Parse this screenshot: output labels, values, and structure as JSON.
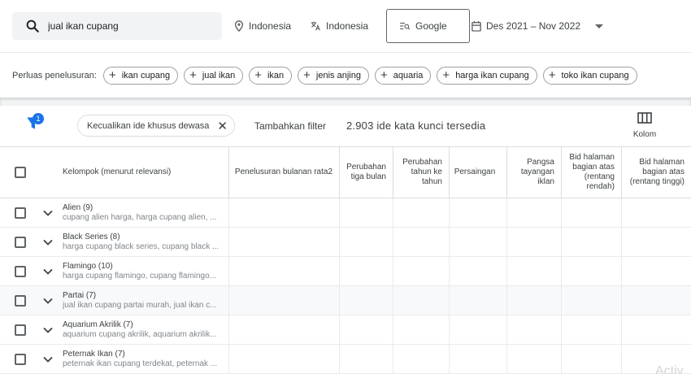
{
  "search": {
    "query": "jual ikan cupang"
  },
  "targeting": {
    "location": "Indonesia",
    "language": "Indonesia",
    "network": "Google",
    "date_range": "Des 2021 – Nov 2022"
  },
  "broaden": {
    "label": "Perluas penelusuran:",
    "chips": [
      "ikan cupang",
      "jual ikan",
      "ikan",
      "jenis anjing",
      "aquaria",
      "harga ikan cupang",
      "toko ikan cupang"
    ]
  },
  "filters": {
    "badge_count": "1",
    "exclude_chip": "Kecualikan ide khusus dewasa",
    "add_filter": "Tambahkan filter",
    "keyword_count": "2.903 ide kata kunci tersedia",
    "columns_label": "Kolom"
  },
  "table": {
    "headers": {
      "group": "Kelompok (menurut relevansi)",
      "avg_searches": "Penelusuran bulanan rata2",
      "three_month": "Perubahan tiga bulan",
      "yoy": "Perubahan tahun ke tahun",
      "competition": "Persaingan",
      "impr_share": "Pangsa tayangan iklan",
      "bid_low": "Bid halaman bagian atas (rentang rendah)",
      "bid_high": "Bid halaman bagian atas (rentang tinggi)"
    },
    "rows": [
      {
        "name": "Alien (9)",
        "keywords": "cupang alien harga, harga cupang alien, ..."
      },
      {
        "name": "Black Series (8)",
        "keywords": "harga cupang black series, cupang black ..."
      },
      {
        "name": "Flamingo (10)",
        "keywords": "harga cupang flamingo, cupang flamingo..."
      },
      {
        "name": "Partai (7)",
        "keywords": "jual ikan cupang partai murah, jual ikan c..."
      },
      {
        "name": "Aquarium Akrilik (7)",
        "keywords": "aquarium cupang akrilik, aquarium akrilik..."
      },
      {
        "name": "Peternak Ikan (7)",
        "keywords": "peternak ikan cupang terdekat, peternak ..."
      }
    ]
  },
  "watermark": "Activ"
}
